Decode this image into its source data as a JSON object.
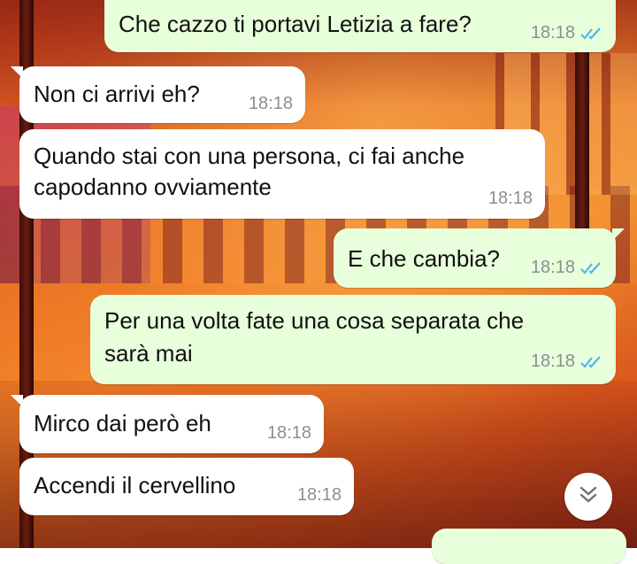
{
  "messages": [
    {
      "id": 1,
      "direction": "outgoing",
      "text": "Che cazzo ti portavi Letizia a fare?",
      "time": "18:18",
      "status": "read"
    },
    {
      "id": 2,
      "direction": "incoming",
      "text": "Non ci arrivi eh?",
      "time": "18:18"
    },
    {
      "id": 3,
      "direction": "incoming",
      "lines": [
        "Quando stai con una persona, ci fai anche",
        "capodanno ovviamente"
      ],
      "time": "18:18"
    },
    {
      "id": 4,
      "direction": "outgoing",
      "text": "E che cambia?",
      "time": "18:18",
      "status": "read"
    },
    {
      "id": 5,
      "direction": "outgoing",
      "lines": [
        "Per una volta fate una cosa separata che",
        "sarà mai"
      ],
      "time": "18:18",
      "status": "read"
    },
    {
      "id": 6,
      "direction": "incoming",
      "text": "Mirco dai però eh",
      "time": "18:18"
    },
    {
      "id": 7,
      "direction": "incoming",
      "text": "Accendi il cervellino",
      "time": "18:18"
    }
  ],
  "scroll_button": {
    "icon": "double-chevron-down-icon"
  },
  "colors": {
    "incoming_bubble": "#ffffff",
    "outgoing_bubble": "#e7ffdb",
    "read_ticks": "#4fb6ec",
    "timestamp": "#8a8f94"
  }
}
